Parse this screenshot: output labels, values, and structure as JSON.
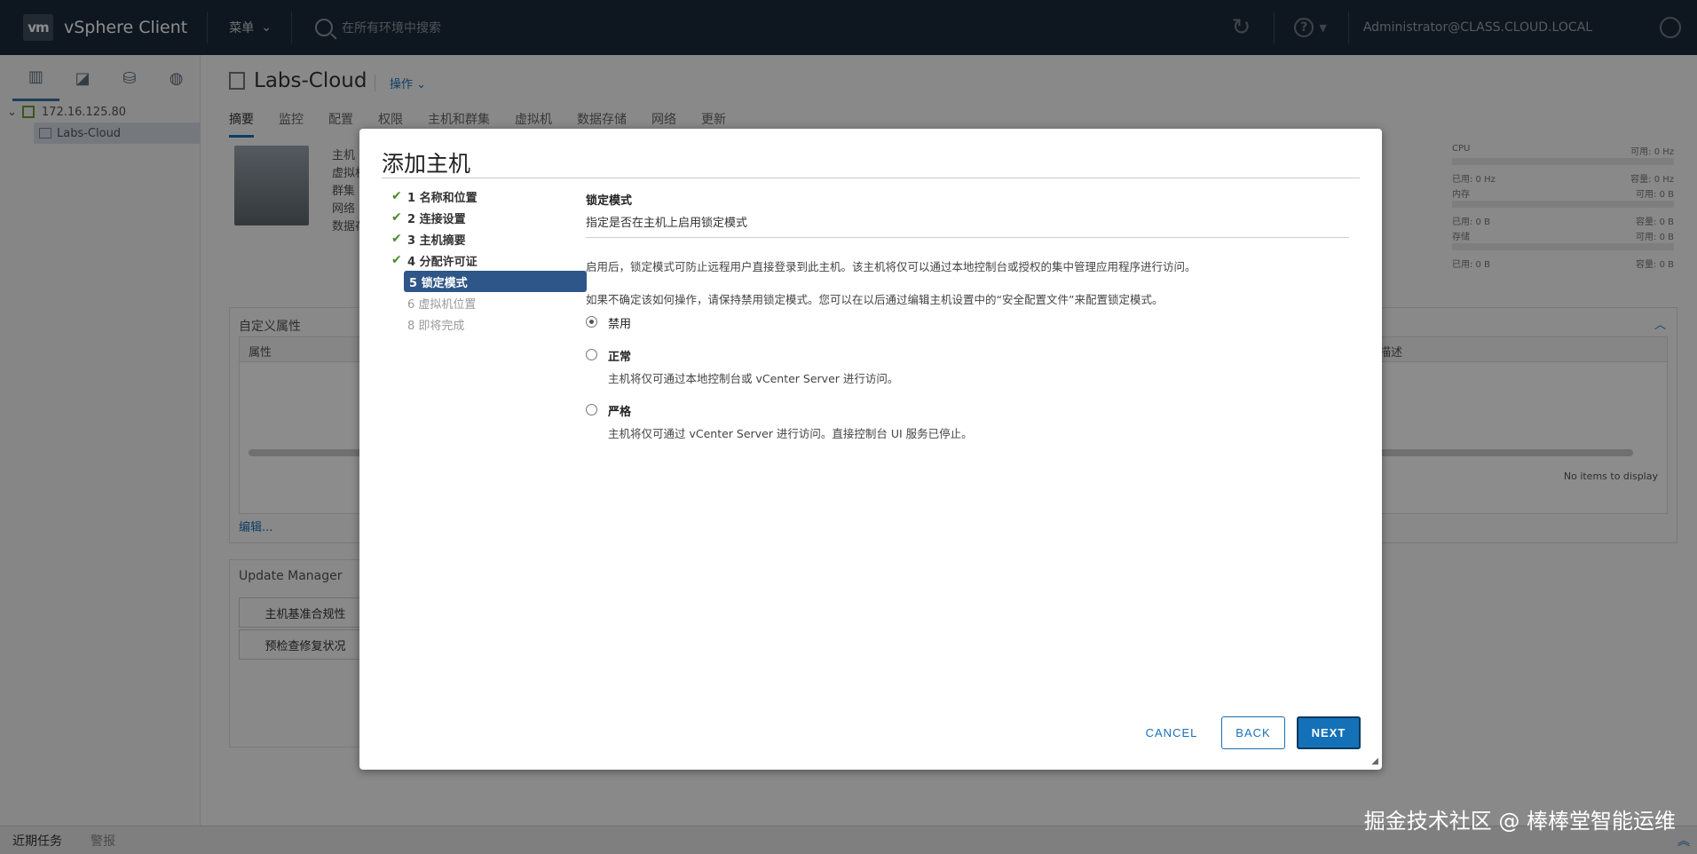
{
  "header": {
    "logo": "vm",
    "app_name": "vSphere Client",
    "menu_label": "菜单",
    "search_placeholder": "在所有环境中搜索",
    "user": "Administrator@CLASS.CLOUD.LOCAL"
  },
  "navigator": {
    "tree": [
      {
        "label": "172.16.125.80"
      },
      {
        "label": "Labs-Cloud"
      }
    ]
  },
  "main": {
    "title": "Labs-Cloud",
    "actions_label": "操作",
    "tabs": [
      "摘要",
      "监控",
      "配置",
      "权限",
      "主机和群集",
      "虚拟机",
      "数据存储",
      "网络",
      "更新"
    ],
    "summary_keys": [
      "主机",
      "虚拟机",
      "群集",
      "网络",
      "数据存"
    ],
    "resources": {
      "cpu_label": "CPU",
      "cpu_free": "可用: 0 Hz",
      "cpu_used": "已用: 0 Hz",
      "cpu_cap": "容量: 0 Hz",
      "mem_label": "内存",
      "mem_free": "可用: 0 B",
      "mem_used": "已用: 0 B",
      "mem_cap": "容量: 0 B",
      "storage_label": "存储",
      "storage_free": "可用: 0 B",
      "storage_used": "已用: 0 B",
      "storage_cap": "容量: 0 B"
    },
    "custom_attrs": {
      "title": "自定义属性",
      "col_attr": "属性",
      "col_desc": "描述",
      "empty": "No items to display",
      "edit": "编辑..."
    },
    "update_manager": {
      "title": "Update Manager",
      "btn1": "主机基准合规性",
      "btn2": "预检查修复状况"
    }
  },
  "bottombar": {
    "recent_tasks": "近期任务",
    "alarms": "警报"
  },
  "dialog": {
    "title": "添加主机",
    "steps": [
      {
        "label": "1 名称和位置",
        "state": "done"
      },
      {
        "label": "2 连接设置",
        "state": "done"
      },
      {
        "label": "3 主机摘要",
        "state": "done"
      },
      {
        "label": "4 分配许可证",
        "state": "done"
      },
      {
        "label": "5 锁定模式",
        "state": "current"
      },
      {
        "label": "6 虚拟机位置",
        "state": "future"
      },
      {
        "label": "8 即将完成",
        "state": "future"
      }
    ],
    "section_title": "锁定模式",
    "section_subtitle": "指定是否在主机上启用锁定模式",
    "paragraph1": "启用后，锁定模式可防止远程用户直接登录到此主机。该主机将仅可以通过本地控制台或授权的集中管理应用程序进行访问。",
    "paragraph2": "如果不确定该如何操作，请保持禁用锁定模式。您可以在以后通过编辑主机设置中的“安全配置文件”来配置锁定模式。",
    "options": [
      {
        "label": "禁用",
        "desc": "",
        "selected": true
      },
      {
        "label": "正常",
        "desc": "主机将仅可通过本地控制台或 vCenter Server 进行访问。",
        "selected": false
      },
      {
        "label": "严格",
        "desc": "主机将仅可通过 vCenter Server 进行访问。直接控制台 UI 服务已停止。",
        "selected": false
      }
    ],
    "buttons": {
      "cancel": "CANCEL",
      "back": "BACK",
      "next": "NEXT"
    }
  },
  "watermark": "掘金技术社区 @ 棒棒堂智能运维",
  "colors": {
    "header_bg": "#1b2a3a",
    "accent": "#1471b8",
    "step_current": "#2e5688",
    "check": "#4a8a28"
  }
}
